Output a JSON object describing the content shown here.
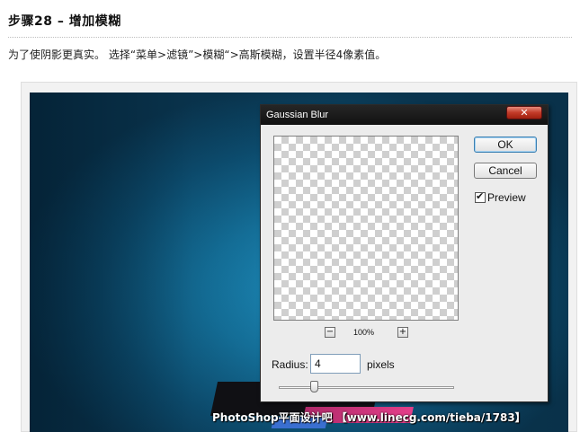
{
  "article": {
    "step_title": "步骤28 – 增加模糊",
    "description": "为了使阴影更真实。 选择“菜单>滤镜”>模糊“>高斯模糊，设置半径4像素值。"
  },
  "screenshot": {
    "watermark": "PhotoShop平面设计吧 【www.linecg.com/tieba/1783】",
    "background_colors": [
      "#1f8fbf",
      "#0a3650"
    ]
  },
  "dialog": {
    "title": "Gaussian Blur",
    "close_icon": "✕",
    "ok_label": "OK",
    "cancel_label": "Cancel",
    "preview_checked": true,
    "preview_check_mark": "✔",
    "preview_label": "Preview",
    "zoom_out_icon": "−",
    "zoom_in_icon": "+",
    "zoom_level": "100%",
    "radius_label": "Radius:",
    "radius_value": "4",
    "radius_unit": "pixels",
    "radius_slider_fraction": 0.2
  }
}
